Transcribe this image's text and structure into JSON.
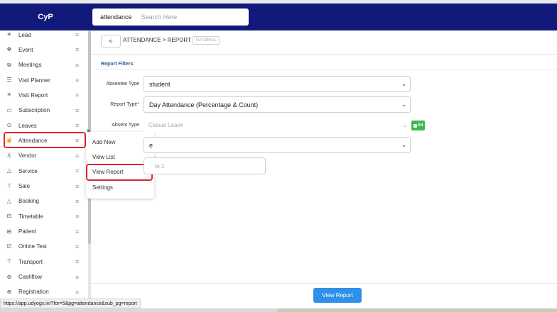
{
  "app": {
    "logo": "CyP"
  },
  "search": {
    "module": "attendance",
    "placeholder": "Search Here"
  },
  "sidebar": {
    "items": [
      {
        "label": "Lead",
        "icon": "lead-icon",
        "glyph": "☀"
      },
      {
        "label": "Event",
        "icon": "event-icon",
        "glyph": "✥"
      },
      {
        "label": "Meetings",
        "icon": "meetings-icon",
        "glyph": "⧉"
      },
      {
        "label": "Visit Planner",
        "icon": "visit-planner-icon",
        "glyph": "☰"
      },
      {
        "label": "Visit Report",
        "icon": "visit-report-icon",
        "glyph": "☀"
      },
      {
        "label": "Subscription",
        "icon": "subscription-icon",
        "glyph": "▭"
      },
      {
        "label": "Leaves",
        "icon": "leaves-icon",
        "glyph": "⊙"
      },
      {
        "label": "Attendance",
        "icon": "attendance-icon",
        "glyph": "☝"
      },
      {
        "label": "Vendor",
        "icon": "vendor-icon",
        "glyph": "♙"
      },
      {
        "label": "Service",
        "icon": "service-icon",
        "glyph": "△"
      },
      {
        "label": "Sale",
        "icon": "sale-icon",
        "glyph": "⊤"
      },
      {
        "label": "Booking",
        "icon": "booking-icon",
        "glyph": "△"
      },
      {
        "label": "Timetable",
        "icon": "timetable-icon",
        "glyph": "⊟"
      },
      {
        "label": "Patient",
        "icon": "patient-icon",
        "glyph": "⊞"
      },
      {
        "label": "Online Test",
        "icon": "online-test-icon",
        "glyph": "☑"
      },
      {
        "label": "Transport",
        "icon": "transport-icon",
        "glyph": "⊤"
      },
      {
        "label": "Cashflow",
        "icon": "cashflow-icon",
        "glyph": "⊛"
      },
      {
        "label": "Registration",
        "icon": "registration-icon",
        "glyph": "⊕"
      }
    ],
    "menu_glyph": "≡"
  },
  "submenu": {
    "items": [
      {
        "label": "Add New"
      },
      {
        "label": "View List"
      },
      {
        "label": "View Report"
      },
      {
        "label": "Settings"
      }
    ]
  },
  "breadcrumb": {
    "back": "<",
    "path": "ATTENDANCE > REPORT",
    "tutorial": "TUTORIAL"
  },
  "filters": {
    "title": "Report Filters",
    "absentee_type": {
      "label": "Absentee Type",
      "value": "student"
    },
    "report_type": {
      "label": "Report Type",
      "required_mark": "*",
      "value": "Day Attendance (Percentage & Count)"
    },
    "absent_type": {
      "label": "Absent Type",
      "value": "Casual Leave",
      "all_label": "All"
    },
    "row4": {
      "value": "e"
    },
    "date": {
      "placeholder": "te 1"
    },
    "chevron": "⌄"
  },
  "footer": {
    "view_report": "View Report"
  },
  "status": {
    "url": "https://app.udyogx.in/?for=5&pg=attendance&sub_pg=report"
  },
  "colors": {
    "header": "#11197a",
    "highlight": "#e0262f",
    "primary_button": "#2e90e8",
    "all_badge": "#3db94e",
    "section_title": "#1f5c9f"
  }
}
